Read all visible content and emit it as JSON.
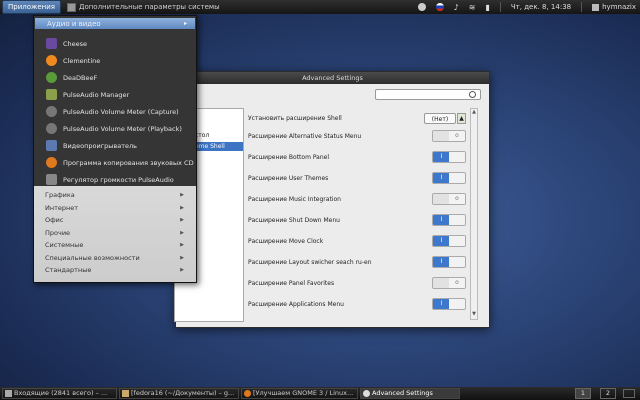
{
  "topbar": {
    "apps_label": "Приложения",
    "window_title": "Дополнительные параметры системы",
    "clock": "Чт, дек.  8, 14:38",
    "user": "hymnazix"
  },
  "menu": {
    "header": "Аудио и видео",
    "items": [
      {
        "label": "Cheese"
      },
      {
        "label": "Clementine"
      },
      {
        "label": "DeaDBeeF"
      },
      {
        "label": "PulseAudio Manager"
      },
      {
        "label": "PulseAudio Volume Meter (Capture)"
      },
      {
        "label": "PulseAudio Volume Meter (Playback)"
      },
      {
        "label": "Видеопроигрыватель"
      },
      {
        "label": "Программа копирования звуковых CD"
      },
      {
        "label": "Регулятор громкости PulseAudio"
      }
    ],
    "categories": [
      {
        "label": "Графика"
      },
      {
        "label": "Интернет"
      },
      {
        "label": "Офис"
      },
      {
        "label": "Прочие"
      },
      {
        "label": "Системные"
      },
      {
        "label": "Специальные возможности"
      },
      {
        "label": "Стандартные"
      }
    ]
  },
  "window": {
    "title": "Advanced Settings",
    "sidebar": [
      {
        "label": "стол"
      },
      {
        "label": "ome Shell"
      }
    ],
    "install_label": "Установить расширение Shell",
    "install_combo": "(Нет)",
    "rows": [
      {
        "label": "Расширение Alternative Status Menu",
        "state": "off"
      },
      {
        "label": "Расширение Bottom Panel",
        "state": "on"
      },
      {
        "label": "Расширение User Themes",
        "state": "on"
      },
      {
        "label": "Расширение Music Integration",
        "state": "off"
      },
      {
        "label": "Расширение Shut Down Menu",
        "state": "on"
      },
      {
        "label": "Расширение Move Clock",
        "state": "on"
      },
      {
        "label": "Расширение Layout swicher seach ru-en",
        "state": "on"
      },
      {
        "label": "Расширение Panel Favorites",
        "state": "off"
      },
      {
        "label": "Расширение Applications Menu",
        "state": "on"
      }
    ],
    "toggle_on_text": "I",
    "toggle_off_text": "o"
  },
  "taskbar": {
    "tasks": [
      {
        "label": "Входящие (2841 всего) – ..."
      },
      {
        "label": "[fedora16 (~/Документы) – g..."
      },
      {
        "label": "[Улучшаем GNOME 3 / Linux..."
      },
      {
        "label": "Advanced Settings"
      }
    ],
    "workspaces": [
      "1",
      "2"
    ]
  },
  "colors": {
    "accent": "#3d78cc",
    "desktop": "#2a4274"
  }
}
